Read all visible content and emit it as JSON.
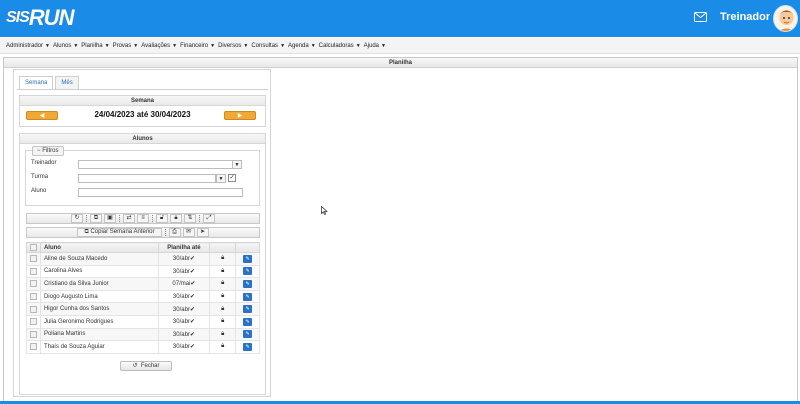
{
  "header": {
    "logo_sis": "SIS",
    "logo_run": "RUN",
    "user_name": "Treinador",
    "mail_icon": "envelope-icon",
    "avatar_icon": "user-avatar-icon",
    "brand_color": "#1a8ce8"
  },
  "menu": [
    {
      "label": "Administrador"
    },
    {
      "label": "Alunos"
    },
    {
      "label": "Planilha"
    },
    {
      "label": "Provas"
    },
    {
      "label": "Avaliações"
    },
    {
      "label": "Financeiro"
    },
    {
      "label": "Diversos"
    },
    {
      "label": "Consultas"
    },
    {
      "label": "Agenda"
    },
    {
      "label": "Calculadoras"
    },
    {
      "label": "Ajuda"
    }
  ],
  "frame": {
    "title": "Planilha"
  },
  "tabs": [
    {
      "label": "Semana"
    },
    {
      "label": "Mês"
    }
  ],
  "semana": {
    "title": "Semana",
    "range": "24/04/2023 até 30/04/2023",
    "prev_icon": "arrow-left-icon",
    "next_icon": "arrow-right-icon"
  },
  "alunos": {
    "title": "Alunos",
    "filters_label": "Filtros",
    "treinador_label": "Treinador",
    "turma_label": "Turma",
    "aluno_label": "Aluno",
    "treinador_value": "",
    "turma_value": "",
    "aluno_value": "",
    "turma_checked": true,
    "copy_label": "Copiar Semana Anterior",
    "columns": {
      "aluno": "Aluno",
      "planilha": "Planilha até"
    },
    "rows": [
      {
        "name": "Aline de Souza Macedo",
        "date": "30/abr"
      },
      {
        "name": "Carolina Alves",
        "date": "30/abr"
      },
      {
        "name": "Cristiano da Silva Junior",
        "date": "07/mai"
      },
      {
        "name": "Diogo Augusto Lima",
        "date": "30/abr"
      },
      {
        "name": "Higor Cunha dos Santos",
        "date": "30/abr"
      },
      {
        "name": "Julia Geronimo Rodrigues",
        "date": "30/abr"
      },
      {
        "name": "Poliana Martins",
        "date": "30/abr"
      },
      {
        "name": "Thaís de Souza Aguiar",
        "date": "30/abr"
      }
    ],
    "close_label": "Fechar"
  }
}
